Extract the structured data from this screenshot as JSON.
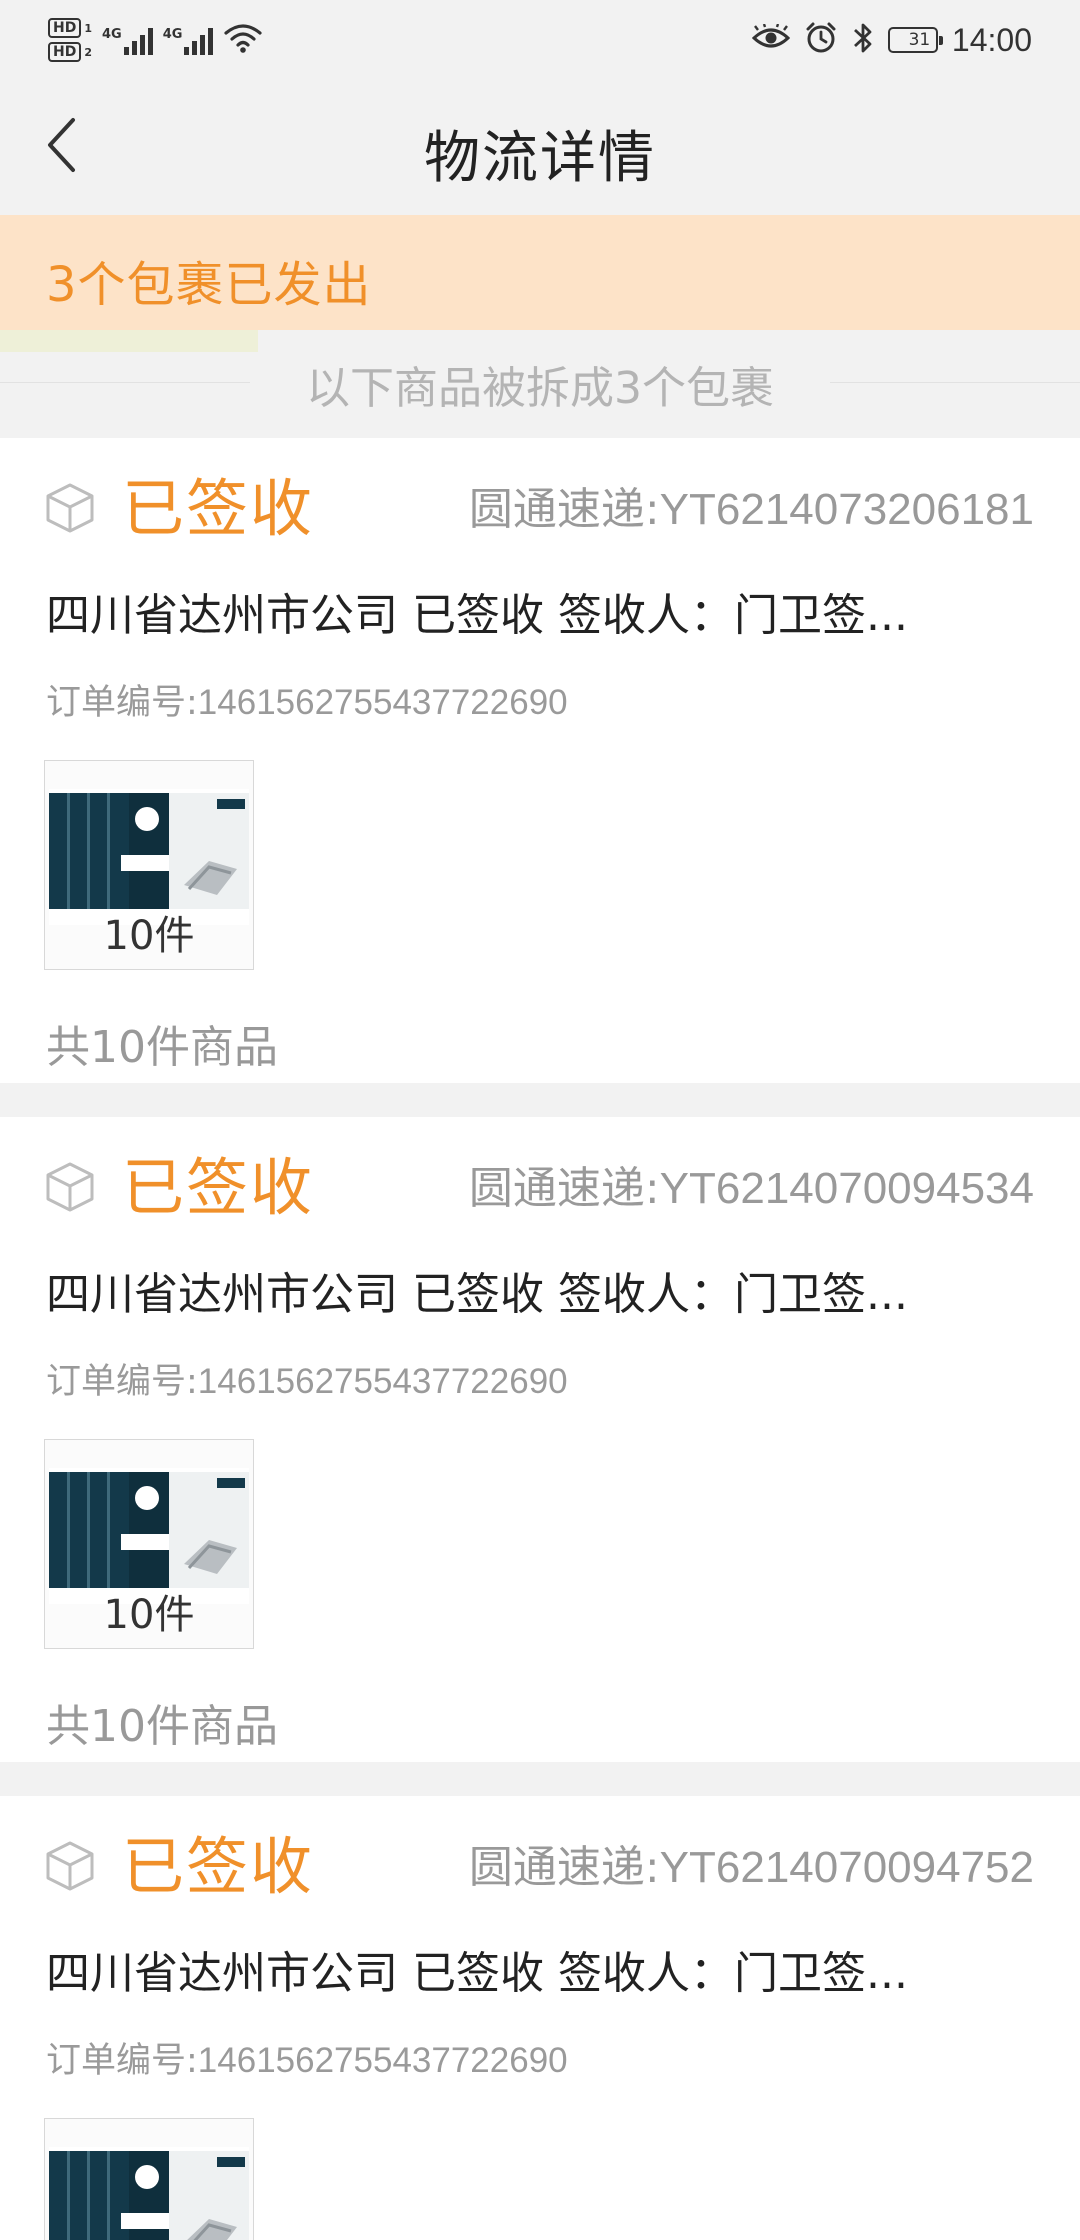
{
  "status_bar": {
    "sim1": "HD",
    "sim1_slot": "1",
    "sim2": "HD",
    "sim2_slot": "2",
    "network1": "4G",
    "network2": "4G",
    "icons": [
      "eye-icon",
      "alarm-icon",
      "bluetooth-icon",
      "battery-icon"
    ],
    "battery": "31",
    "battery_level": 0.31,
    "time": "14:00"
  },
  "header": {
    "title": "物流详情",
    "back_icon": "chevron-left-icon"
  },
  "banner": {
    "text": "3个包裹已发出"
  },
  "split_notice": {
    "text": "以下商品被拆成3个包裹"
  },
  "colors": {
    "accent": "#f0902a",
    "banner_bg": "#fde3c8",
    "page_bg": "#f2f2f2"
  },
  "packages": [
    {
      "status": "已签收",
      "carrier": "圆通速递:",
      "tracking_no": "YT6214073206181",
      "latest": "四川省达州市公司 已签收 签收人：门卫签...",
      "order_label": "订单编号:",
      "order_no": "1461562755437722690",
      "quantity": "10件",
      "total": "共10件商品"
    },
    {
      "status": "已签收",
      "carrier": "圆通速递:",
      "tracking_no": "YT6214070094534",
      "latest": "四川省达州市公司 已签收 签收人：门卫签...",
      "order_label": "订单编号:",
      "order_no": "1461562755437722690",
      "quantity": "10件",
      "total": "共10件商品"
    },
    {
      "status": "已签收",
      "carrier": "圆通速递:",
      "tracking_no": "YT6214070094752",
      "latest": "四川省达州市公司 已签收 签收人：门卫签...",
      "order_label": "订单编号:",
      "order_no": "1461562755437722690",
      "quantity": "",
      "total": ""
    }
  ]
}
